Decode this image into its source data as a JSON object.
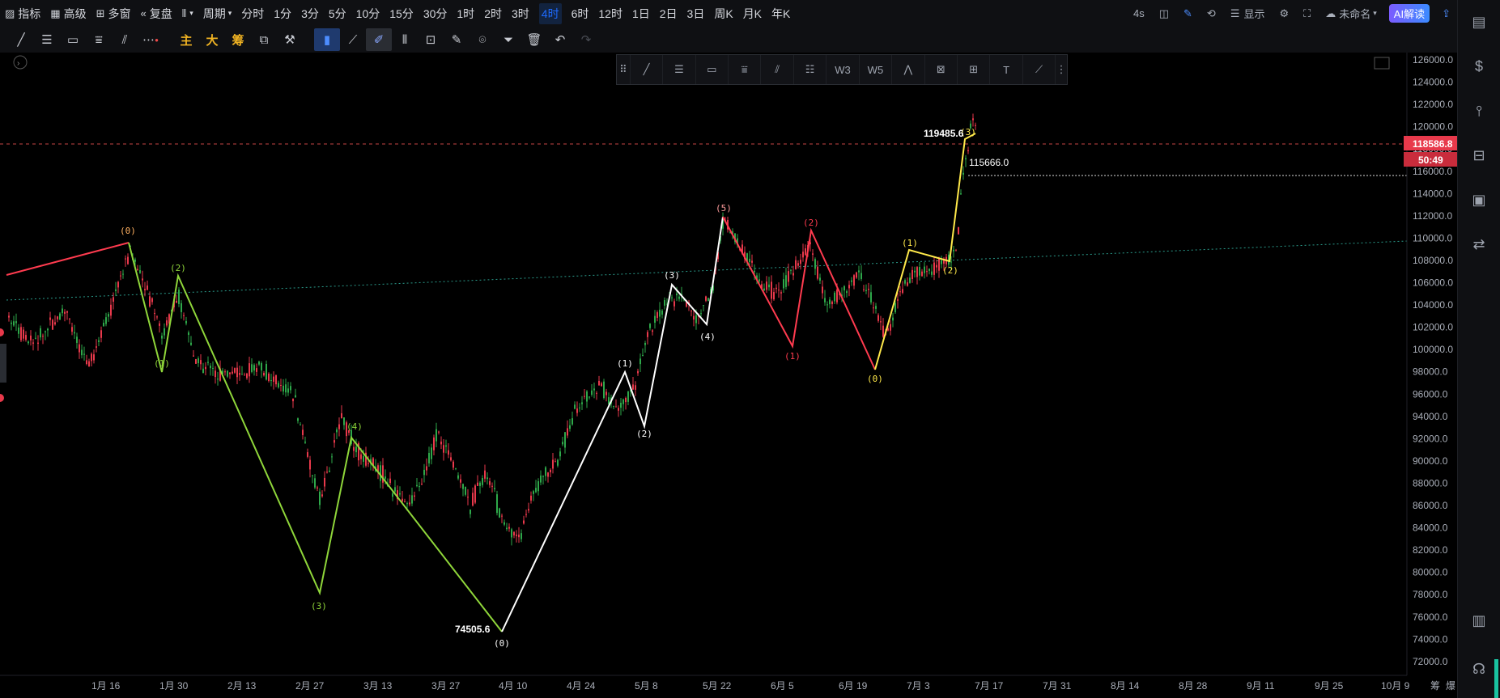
{
  "toolbar": {
    "indicators": "指标",
    "advanced": "高级",
    "multi_window": "多窗",
    "replay": "复盘",
    "chart_type_icon": "candle-bars-icon",
    "period_menu": "周期",
    "periods": [
      "分时",
      "1分",
      "3分",
      "5分",
      "10分",
      "15分",
      "30分",
      "1时",
      "2时",
      "3时",
      "4时",
      "6时",
      "12时",
      "1日",
      "2日",
      "3日",
      "周K",
      "月K",
      "年K"
    ],
    "active_period": "4时",
    "right": {
      "countdown": "4s",
      "display": "显示",
      "layout_name": "未命名",
      "ai_button": "AI解读"
    }
  },
  "drawing_tools": {
    "chinese_buttons": [
      "主",
      "大",
      "筹"
    ]
  },
  "colors": {
    "background": "#000000",
    "up": "#2ea84a",
    "down": "#e8394b",
    "accent": "#1e6bff",
    "wave_green": "#8fd63a",
    "wave_white": "#ffffff",
    "wave_red": "#ff3b4f",
    "wave_yellow": "#ffe94a"
  },
  "price_axis": {
    "labels": [
      "126000.0",
      "124000.0",
      "122000.0",
      "120000.0",
      "118000.0",
      "116000.0",
      "114000.0",
      "112000.0",
      "110000.0",
      "108000.0",
      "106000.0",
      "104000.0",
      "102000.0",
      "100000.0",
      "98000.0",
      "96000.0",
      "94000.0",
      "92000.0",
      "90000.0",
      "88000.0",
      "86000.0",
      "84000.0",
      "82000.0",
      "80000.0",
      "78000.0",
      "76000.0",
      "74000.0",
      "72000.0"
    ],
    "current_price": "118586.8",
    "countdown": "50:49"
  },
  "time_axis": {
    "labels": [
      "1月 16",
      "1月 30",
      "2月 13",
      "2月 27",
      "3月 13",
      "3月 27",
      "4月 10",
      "4月 24",
      "5月 8",
      "5月 22",
      "6月 5",
      "6月 19",
      "7月 3",
      "7月 17",
      "7月 31",
      "8月 14",
      "8月 28",
      "9月 11",
      "9月 25",
      "10月 9"
    ],
    "right_text": [
      "筹",
      "爆"
    ]
  },
  "annotations": {
    "high_price": "119485.6",
    "level_line": "115666.0",
    "low_price": "74505.6"
  },
  "wave_labels": {
    "green": [
      "(0)",
      "(1)",
      "(2)",
      "(3)",
      "(4)"
    ],
    "white": [
      "(0)",
      "(1)",
      "(2)",
      "(3)",
      "(4)",
      "(5)"
    ],
    "red": [
      "(1)",
      "(2)"
    ],
    "yellow": [
      "(0)",
      "(1)",
      "(2)",
      "(3)"
    ]
  }
}
